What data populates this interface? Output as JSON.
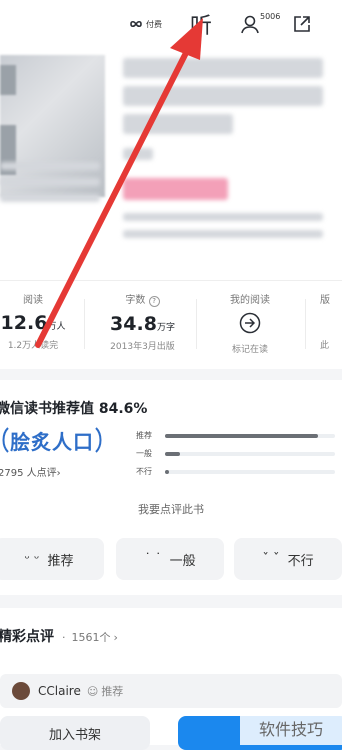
{
  "topbar": {
    "pay_label": "付费",
    "listen_label": "听",
    "user_count": "5006"
  },
  "stats": [
    {
      "label": "阅读",
      "value": "12.6",
      "unit": "万人",
      "sub": "1.2万人读完"
    },
    {
      "label": "字数",
      "value": "34.8",
      "unit": "万字",
      "sub": "2013年3月出版"
    },
    {
      "label": "我的阅读",
      "sub": "标记在读"
    },
    {
      "label": "版",
      "sub": "此"
    }
  ],
  "recommend": {
    "title": "微信读书推荐值 84.6%",
    "badge": "脍炙人口",
    "count": "2795 人点评",
    "bars": [
      {
        "label": "推荐",
        "fraction": 0.9
      },
      {
        "label": "一般",
        "fraction": 0.09
      },
      {
        "label": "不行",
        "fraction": 0.02
      }
    ],
    "prompt": "我要点评此书",
    "buttons": [
      {
        "face": "ᵕ ᵕ",
        "label": "推荐"
      },
      {
        "face": "˙ ˙",
        "label": "一般"
      },
      {
        "face": "ˇ ˇ",
        "label": "不行"
      }
    ]
  },
  "reviews": {
    "title": "精彩点评",
    "count": "1561个",
    "user": "CClaire",
    "tag": "推荐"
  },
  "bottom": {
    "shelf_label": "加入书架",
    "watermark": "软件技巧"
  }
}
